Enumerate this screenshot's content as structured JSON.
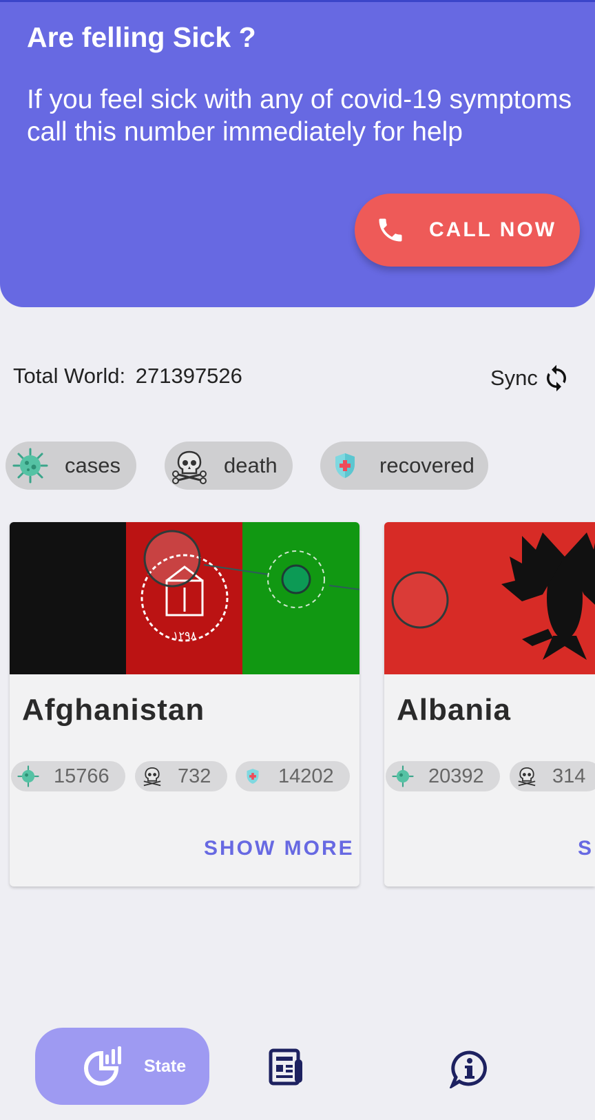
{
  "banner": {
    "title": "Are felling Sick ?",
    "message": "If you feel sick with any of covid-19 symptoms call this number immediately for help",
    "call_button": "CALL NOW",
    "color": "#6769e2",
    "button_color": "#ee5a58"
  },
  "summary": {
    "total_label": "Total World:",
    "total_value": "271397526",
    "sync_label": "Sync"
  },
  "filters": [
    {
      "label": "cases",
      "icon": "virus-icon"
    },
    {
      "label": "death",
      "icon": "skull-icon"
    },
    {
      "label": "recovered",
      "icon": "shield-icon"
    }
  ],
  "countries": [
    {
      "name": "Afghanistan",
      "cases": "15766",
      "deaths": "732",
      "recovered": "14202",
      "action": "SHOW MORE"
    },
    {
      "name": "Albania",
      "cases": "20392",
      "deaths": "314",
      "recovered": "",
      "action": "SHOW MORE"
    }
  ],
  "nav": {
    "state_label": "State",
    "items": [
      "chart-icon",
      "newspaper-icon",
      "info-icon"
    ],
    "active_color": "#9e9af2"
  }
}
